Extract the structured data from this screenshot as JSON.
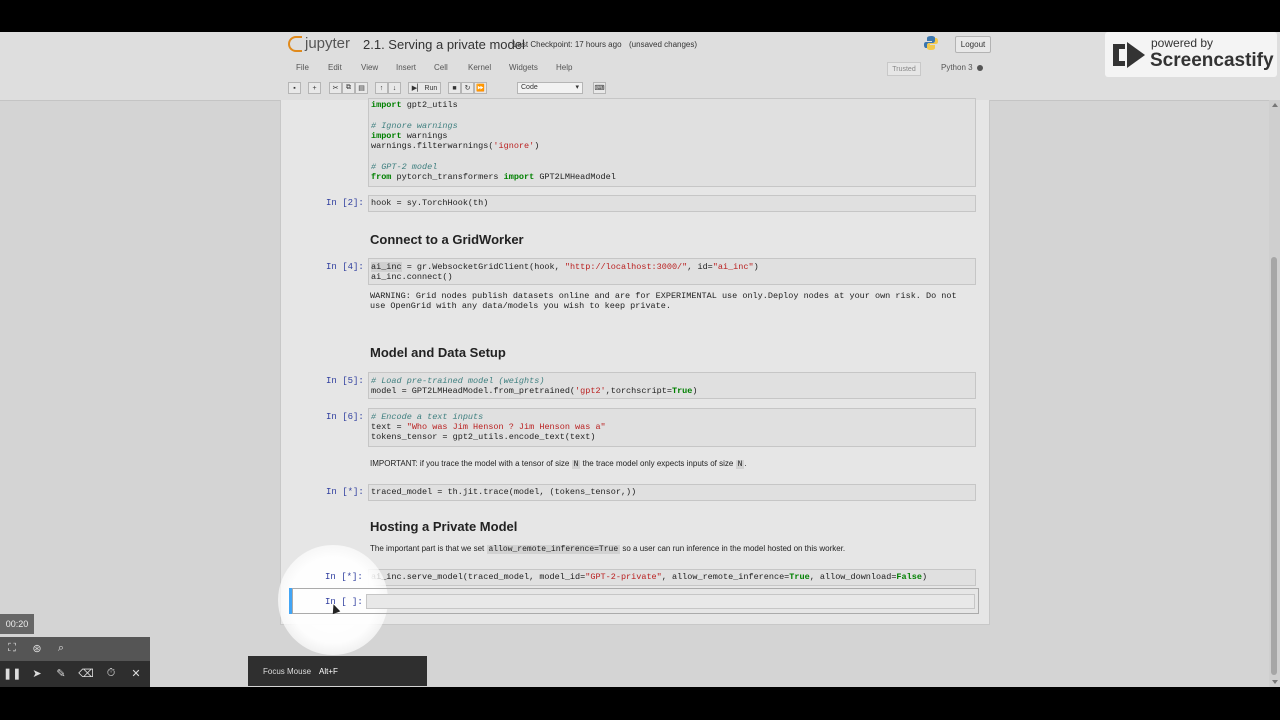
{
  "app": {
    "logo_text": "jupyter",
    "notebook_title": "2.1. Serving a private model",
    "checkpoint": "Last Checkpoint: 17 hours ago",
    "unsaved": "(unsaved changes)",
    "logout_label": "Logout",
    "trusted_label": "Trusted",
    "kernel_name": "Python 3"
  },
  "menu": [
    "File",
    "Edit",
    "View",
    "Insert",
    "Cell",
    "Kernel",
    "Widgets",
    "Help"
  ],
  "toolbar": {
    "run_label": "Run",
    "cell_type": "Code"
  },
  "cells": {
    "c1": {
      "lines": {
        "l1_kw": "import",
        "l1_rest": " gpt2_utils",
        "l2": "# Ignore warnings",
        "l3_kw": "import",
        "l3_rest": " warnings",
        "l4_pre": "warnings.filterwarnings(",
        "l4_str": "'ignore'",
        "l4_post": ")",
        "l5": "# GPT-2 model",
        "l6_kw1": "from",
        "l6_mid": " pytorch_transformers ",
        "l6_kw2": "import",
        "l6_rest": " GPT2LMHeadModel"
      }
    },
    "c2": {
      "prompt": "In [2]:",
      "code": "hook = sy.TorchHook(th)"
    },
    "h_connect": "Connect to a GridWorker",
    "c4": {
      "prompt": "In [4]:",
      "l1_var": "ai_inc",
      "l1_pre": " = gr.WebsocketGridClient(hook, ",
      "l1_str1": "\"http://localhost:3000/\"",
      "l1_mid": ", id=",
      "l1_str2": "\"ai_inc\"",
      "l1_post": ")",
      "l2": "ai_inc.connect()",
      "out1": "WARNING: Grid nodes publish datasets online and are for EXPERIMENTAL use only.Deploy nodes at your own risk. Do not",
      "out2": "use OpenGrid with any data/models you wish to keep private."
    },
    "h_model": "Model and Data Setup",
    "c5": {
      "prompt": "In [5]:",
      "l1": "# Load pre-trained model (weights)",
      "l2_pre": "model = GPT2LMHeadModel.from_pretrained(",
      "l2_str": "'gpt2'",
      "l2_mid": ",torchscript=",
      "l2_kw": "True",
      "l2_post": ")"
    },
    "c6": {
      "prompt": "In [6]:",
      "l1": "# Encode a text inputs",
      "l2_pre": "text = ",
      "l2_str": "\"Who was Jim Henson ? Jim Henson was a\"",
      "l3": "tokens_tensor = gpt2_utils.encode_text(text)"
    },
    "md_important": {
      "pre": "IMPORTANT: if you trace the model with a tensor of size ",
      "code1": "N",
      "mid": " the trace model only expects inputs of size ",
      "code2": "N",
      "post": "."
    },
    "c7": {
      "prompt": "In [*]:",
      "code": "traced_model = th.jit.trace(model, (tokens_tensor,))"
    },
    "h_hosting": "Hosting a Private Model",
    "md_hosting": {
      "pre": "The important part is that we set ",
      "code": "allow_remote_inference=True",
      "post": " so a user can run inference in the model hosted on this worker."
    },
    "c8": {
      "prompt": "In [*]:",
      "pre": "ai_inc.serve_model(traced_model, model_id=",
      "str": "\"GPT-2-private\"",
      "mid1": ", allow_remote_inference=",
      "kw1": "True",
      "mid2": ", allow_download=",
      "kw2": "False",
      "post": ")"
    },
    "c9": {
      "prompt": "In [ ]:"
    }
  },
  "overlay": {
    "powered_by": "powered by",
    "brand": "Screencastify",
    "timer": "00:20",
    "focus_label": "Focus Mouse",
    "focus_shortcut": "Alt+F"
  }
}
